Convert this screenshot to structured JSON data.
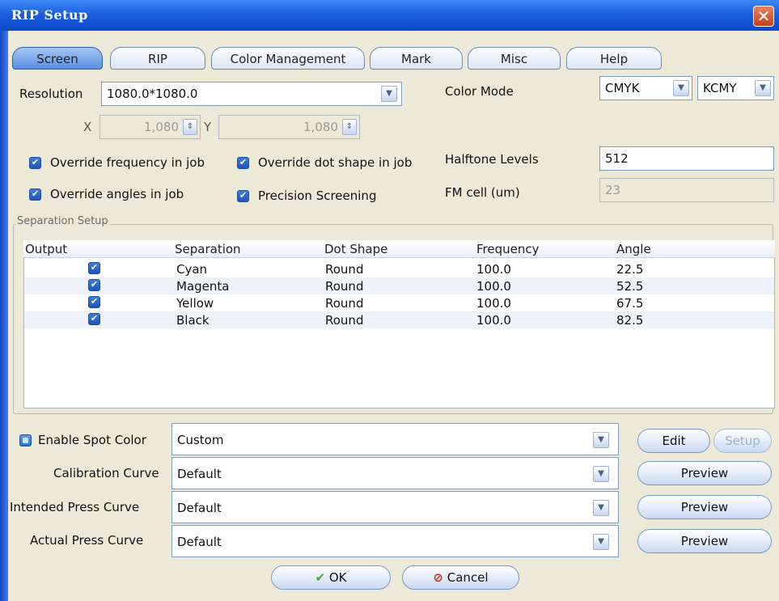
{
  "window": {
    "title": "RIP Setup",
    "close_label": "✕"
  },
  "tabs": [
    {
      "label": "Screen",
      "active": true
    },
    {
      "label": "RIP"
    },
    {
      "label": "Color Management"
    },
    {
      "label": "Mark"
    },
    {
      "label": "Misc"
    },
    {
      "label": "Help"
    }
  ],
  "resolution": {
    "label": "Resolution",
    "value": "1080.0*1080.0",
    "x_label": "X",
    "x_value": "1,080",
    "y_label": "Y",
    "y_value": "1,080"
  },
  "color_mode": {
    "label": "Color Mode",
    "mode": "CMYK",
    "order": "KCMY"
  },
  "checks": {
    "override_frequency": "Override frequency in job",
    "override_dot_shape": "Override dot shape in job",
    "override_angles": "Override angles in job",
    "precision_screening": "Precision Screening"
  },
  "halftone": {
    "label": "Halftone Levels",
    "value": "512"
  },
  "fm_cell": {
    "label": "FM cell (um)",
    "value": "23"
  },
  "separation": {
    "group_label": "Separation Setup",
    "headers": [
      "Output",
      "Separation",
      "Dot Shape",
      "Frequency",
      "Angle"
    ],
    "rows": [
      {
        "separation": "Cyan",
        "dot_shape": "Round",
        "frequency": "100.0",
        "angle": "22.5"
      },
      {
        "separation": "Magenta",
        "dot_shape": "Round",
        "frequency": "100.0",
        "angle": "52.5"
      },
      {
        "separation": "Yellow",
        "dot_shape": "Round",
        "frequency": "100.0",
        "angle": "67.5"
      },
      {
        "separation": "Black",
        "dot_shape": "Round",
        "frequency": "100.0",
        "angle": "82.5"
      }
    ]
  },
  "spot": {
    "label": "Enable Spot Color",
    "value": "Custom",
    "edit": "Edit",
    "setup": "Setup"
  },
  "calibration": {
    "label": "Calibration Curve",
    "value": "Default",
    "preview": "Preview"
  },
  "intended": {
    "label": "Intended Press Curve",
    "value": "Default",
    "preview": "Preview"
  },
  "actual": {
    "label": "Actual Press Curve",
    "value": "Default",
    "preview": "Preview"
  },
  "footer": {
    "ok": "OK",
    "cancel": "Cancel"
  },
  "icons": {
    "checkmark": "✔",
    "dropdown": "▼",
    "ok_icon": "✔",
    "cancel_icon": "⊘"
  }
}
